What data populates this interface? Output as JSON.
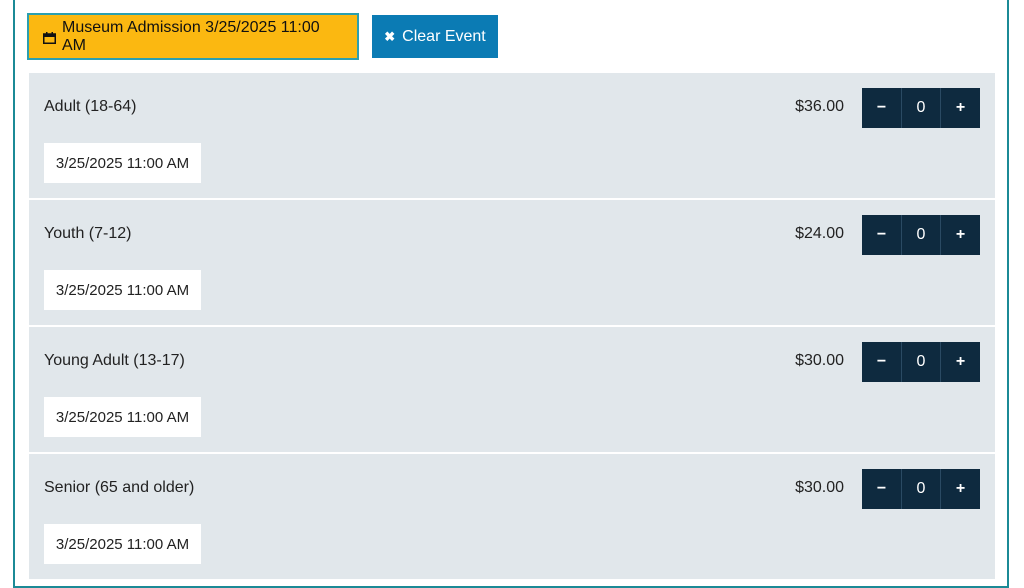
{
  "toolbar": {
    "event_label": "Museum Admission 3/25/2025 11:00 AM",
    "event_icon": "calendar-icon",
    "clear_label": "Clear Event",
    "clear_icon": "close-icon"
  },
  "tickets": [
    {
      "label": "Adult (18-64)",
      "price": "$36.00",
      "quantity": "0",
      "date": "3/25/2025 11:00 AM"
    },
    {
      "label": "Youth (7-12)",
      "price": "$24.00",
      "quantity": "0",
      "date": "3/25/2025 11:00 AM"
    },
    {
      "label": "Young Adult (13-17)",
      "price": "$30.00",
      "quantity": "0",
      "date": "3/25/2025 11:00 AM"
    },
    {
      "label": "Senior (65 and older)",
      "price": "$30.00",
      "quantity": "0",
      "date": "3/25/2025 11:00 AM"
    }
  ],
  "stepper": {
    "minus": "−",
    "plus": "+"
  },
  "colors": {
    "event_button": "#fbb811",
    "clear_button": "#0b7bb4",
    "stepper": "#0e2a3f",
    "row_background": "#e1e7eb",
    "frame_border": "#1b8a96"
  }
}
